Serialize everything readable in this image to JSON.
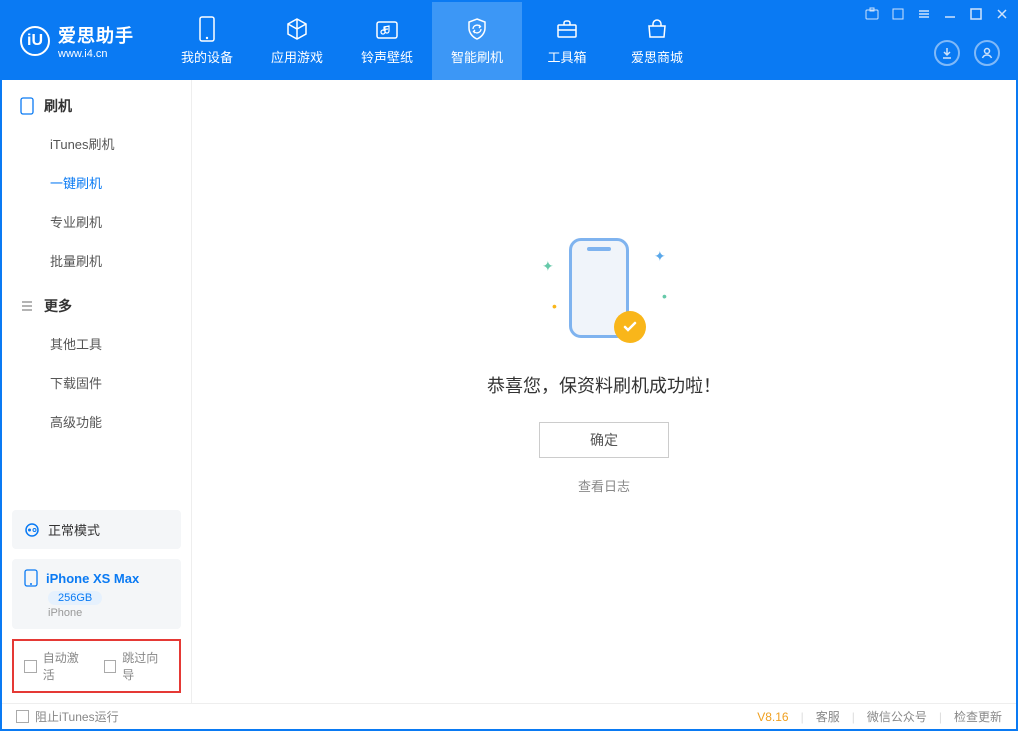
{
  "app": {
    "name_cn": "爱思助手",
    "url": "www.i4.cn",
    "logo_letter": "iU"
  },
  "nav": [
    {
      "label": "我的设备",
      "icon": "device"
    },
    {
      "label": "应用游戏",
      "icon": "cube"
    },
    {
      "label": "铃声壁纸",
      "icon": "music"
    },
    {
      "label": "智能刷机",
      "icon": "refresh"
    },
    {
      "label": "工具箱",
      "icon": "toolbox"
    },
    {
      "label": "爱思商城",
      "icon": "store"
    }
  ],
  "sidebar": {
    "sec1_title": "刷机",
    "sec1": [
      {
        "label": "iTunes刷机"
      },
      {
        "label": "一键刷机"
      },
      {
        "label": "专业刷机"
      },
      {
        "label": "批量刷机"
      }
    ],
    "sec2_title": "更多",
    "sec2": [
      {
        "label": "其他工具"
      },
      {
        "label": "下载固件"
      },
      {
        "label": "高级功能"
      }
    ]
  },
  "mode": {
    "label": "正常模式"
  },
  "device": {
    "name": "iPhone XS Max",
    "storage": "256GB",
    "type": "iPhone"
  },
  "flags": {
    "auto_activate": "自动激活",
    "skip_guide": "跳过向导"
  },
  "main": {
    "success_msg": "恭喜您，保资料刷机成功啦！",
    "ok": "确定",
    "view_log": "查看日志"
  },
  "footer": {
    "block_itunes": "阻止iTunes运行",
    "version": "V8.16",
    "support": "客服",
    "wechat": "微信公众号",
    "update": "检查更新"
  }
}
